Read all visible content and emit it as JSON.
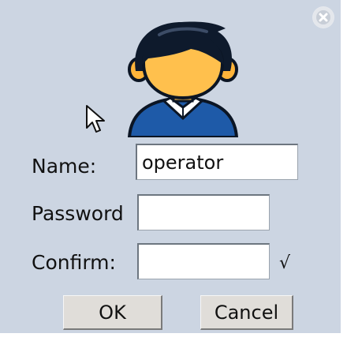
{
  "dialog": {
    "close_icon": "close-circle-icon",
    "avatar_icon": "user-avatar-icon",
    "fields": {
      "name": {
        "label": "Name:",
        "value": "operator"
      },
      "password": {
        "label": "Password",
        "value": ""
      },
      "confirm": {
        "label": "Confirm:",
        "value": "",
        "status": "√"
      }
    },
    "buttons": {
      "ok": "OK",
      "cancel": "Cancel"
    }
  },
  "colors": {
    "background": "#ccd5e2",
    "avatar_shirt": "#1e5aa8",
    "avatar_hair": "#0e1a2c",
    "avatar_skin": "#ffc04d"
  }
}
